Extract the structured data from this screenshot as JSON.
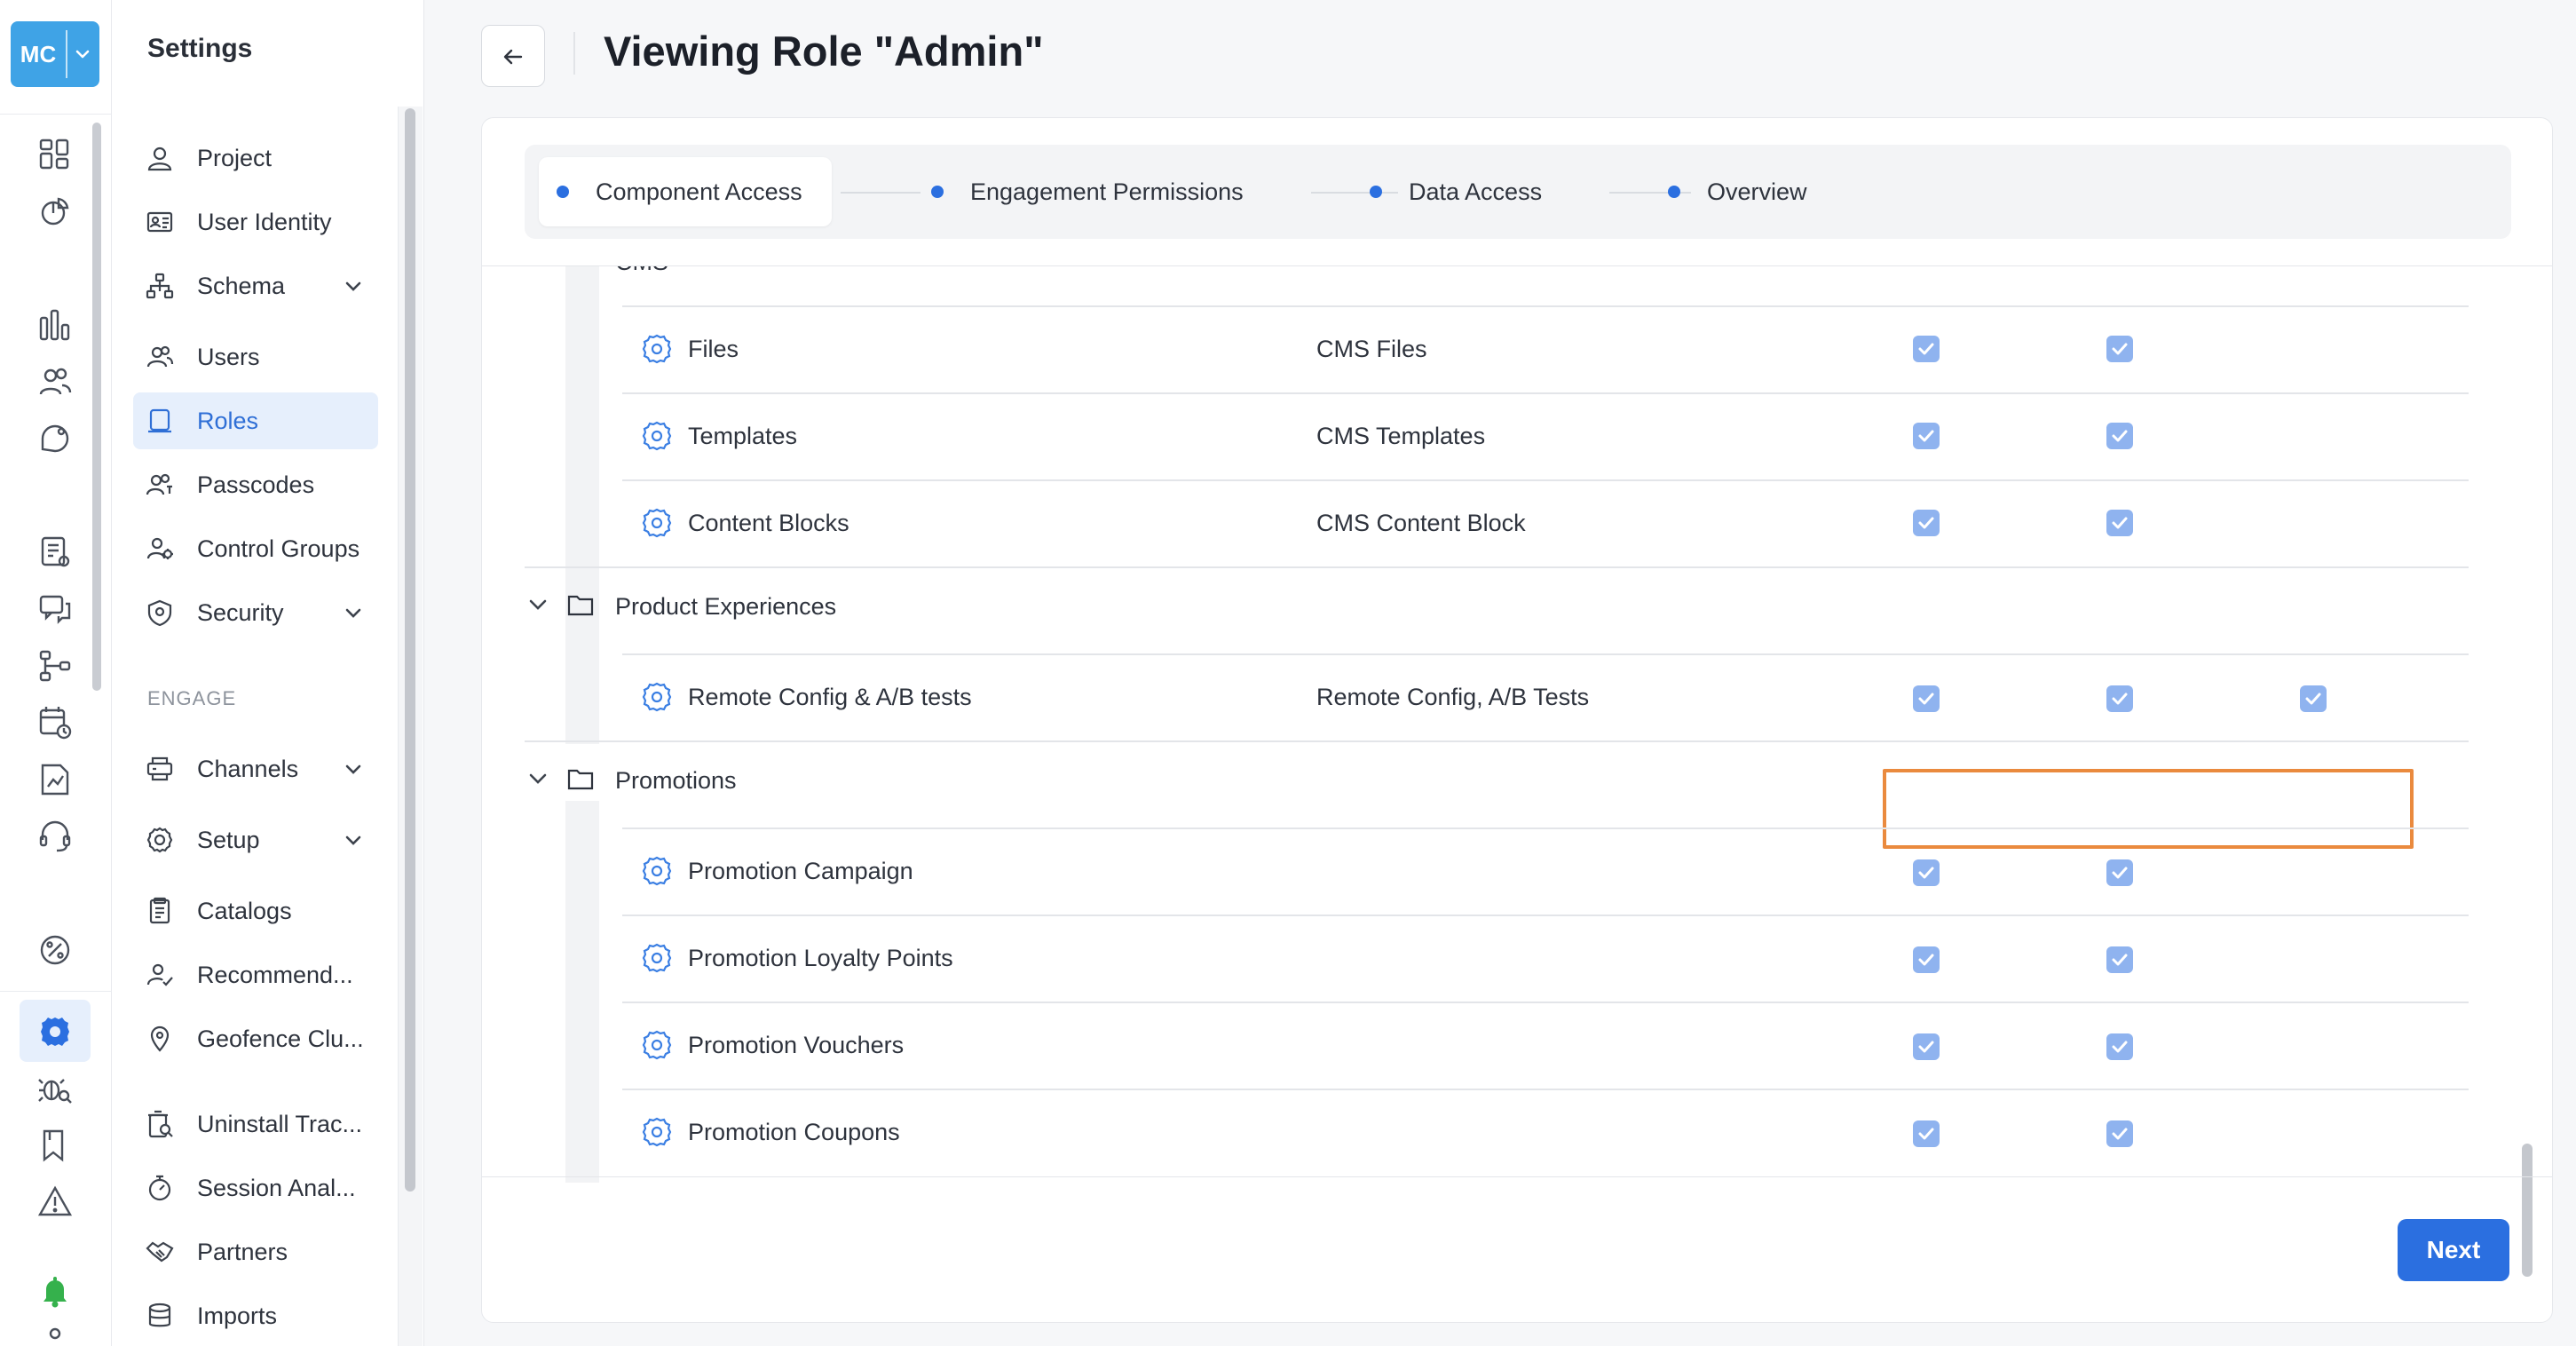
{
  "workspace_badge": {
    "initials": "MC"
  },
  "icons": {
    "rail": [
      "dashboard-icon",
      "segments-icon",
      "analytics-icon",
      "users-icon",
      "engage-icon",
      "templates-icon",
      "messages-icon",
      "flows-icon",
      "scheduler-icon",
      "reports-icon",
      "support-icon",
      "percent-icon",
      "settings-icon",
      "debug-icon",
      "bookmark-icon",
      "alert-icon",
      "bell-icon"
    ],
    "row": "gear-icon",
    "group": "folder-icon"
  },
  "colors": {
    "accent": "#2b6fe0",
    "badge": "#3fa3e6",
    "active_bg": "#e6effc",
    "checkbox": "#8fb3ef",
    "highlight": "#ea8a3e",
    "bell": "#35b14c"
  },
  "sidebar": {
    "title": "Settings",
    "section_engage": "ENGAGE",
    "items": [
      {
        "label": "Project",
        "icon": "person-icon"
      },
      {
        "label": "User Identity",
        "icon": "id-card-icon"
      },
      {
        "label": "Schema",
        "icon": "schema-icon",
        "expandable": true
      },
      {
        "label": "Users",
        "icon": "users-icon"
      },
      {
        "label": "Roles",
        "icon": "roles-icon",
        "active": true
      },
      {
        "label": "Passcodes",
        "icon": "passcodes-icon"
      },
      {
        "label": "Control Groups",
        "icon": "control-groups-icon"
      },
      {
        "label": "Security",
        "icon": "shield-icon",
        "expandable": true
      },
      {
        "label": "Channels",
        "icon": "channels-icon",
        "expandable": true
      },
      {
        "label": "Setup",
        "icon": "gear-icon",
        "expandable": true
      },
      {
        "label": "Catalogs",
        "icon": "catalog-icon"
      },
      {
        "label": "Recommend...",
        "icon": "recommend-icon"
      },
      {
        "label": "Geofence Clu...",
        "icon": "pin-icon"
      },
      {
        "label": "Uninstall Trac...",
        "icon": "uninstall-icon"
      },
      {
        "label": "Session Anal...",
        "icon": "stopwatch-icon"
      },
      {
        "label": "Partners",
        "icon": "handshake-icon"
      },
      {
        "label": "Imports",
        "icon": "database-icon"
      }
    ]
  },
  "header": {
    "title": "Viewing Role \"Admin\""
  },
  "stepper": {
    "steps": [
      "Component Access",
      "Engagement Permissions",
      "Data Access",
      "Overview"
    ],
    "active": 0
  },
  "permissions": {
    "partial_group_label": "CMS",
    "groups": [
      {
        "name": "CMS",
        "rows": [
          {
            "name": "Files",
            "component": "CMS Files",
            "checked": [
              true,
              true
            ]
          },
          {
            "name": "Templates",
            "component": "CMS Templates",
            "checked": [
              true,
              true
            ]
          },
          {
            "name": "Content Blocks",
            "component": "CMS Content Block",
            "checked": [
              true,
              true
            ]
          }
        ]
      },
      {
        "name": "Product Experiences",
        "rows": [
          {
            "name": "Remote Config & A/B tests",
            "component": "Remote Config, A/B Tests",
            "checked": [
              true,
              true,
              true
            ],
            "highlighted": true
          }
        ]
      },
      {
        "name": "Promotions",
        "rows": [
          {
            "name": "Promotion Campaign",
            "component": "",
            "checked": [
              true,
              true
            ]
          },
          {
            "name": "Promotion Loyalty Points",
            "component": "",
            "checked": [
              true,
              true
            ]
          },
          {
            "name": "Promotion Vouchers",
            "component": "",
            "checked": [
              true,
              true
            ]
          },
          {
            "name": "Promotion Coupons",
            "component": "",
            "checked": [
              true,
              true
            ]
          }
        ]
      }
    ]
  },
  "footer": {
    "next_label": "Next"
  }
}
